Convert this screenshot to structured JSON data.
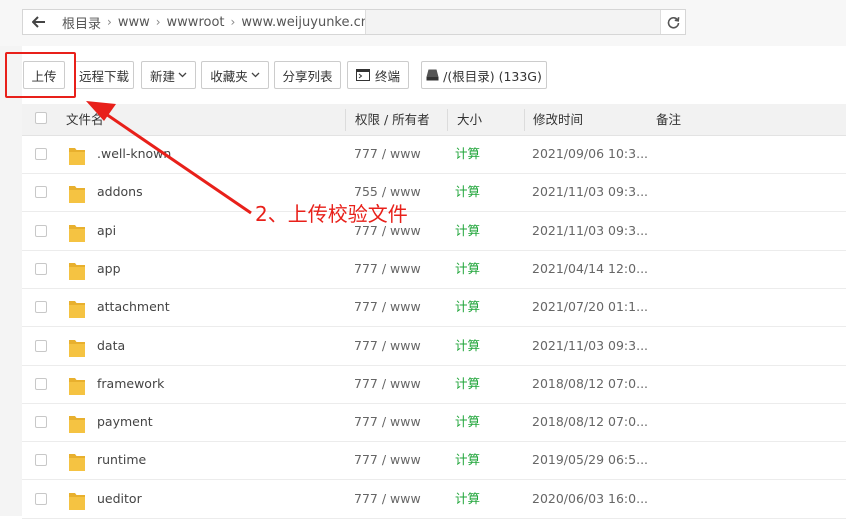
{
  "breadcrumb": [
    "根目录",
    "www",
    "wwwroot",
    "www.weijuyunke.cn"
  ],
  "toolbar": {
    "upload": "上传",
    "remote_download": "远程下载",
    "new": "新建",
    "favorites": "收藏夹",
    "share_list": "分享列表",
    "terminal": "终端",
    "disk": "/(根目录) (133G)"
  },
  "table": {
    "headers": {
      "name": "文件名",
      "perm": "权限 / 所有者",
      "size": "大小",
      "mtime": "修改时间",
      "note": "备注"
    },
    "rows": [
      {
        "name": ".well-known",
        "perm": "777 / www",
        "size": "计算",
        "mtime": "2021/09/06 10:3..."
      },
      {
        "name": "addons",
        "perm": "755 / www",
        "size": "计算",
        "mtime": "2021/11/03 09:3..."
      },
      {
        "name": "api",
        "perm": "777 / www",
        "size": "计算",
        "mtime": "2021/11/03 09:3..."
      },
      {
        "name": "app",
        "perm": "777 / www",
        "size": "计算",
        "mtime": "2021/04/14 12:0..."
      },
      {
        "name": "attachment",
        "perm": "777 / www",
        "size": "计算",
        "mtime": "2021/07/20 01:1..."
      },
      {
        "name": "data",
        "perm": "777 / www",
        "size": "计算",
        "mtime": "2021/11/03 09:3..."
      },
      {
        "name": "framework",
        "perm": "777 / www",
        "size": "计算",
        "mtime": "2018/08/12 07:0..."
      },
      {
        "name": "payment",
        "perm": "777 / www",
        "size": "计算",
        "mtime": "2018/08/12 07:0..."
      },
      {
        "name": "runtime",
        "perm": "777 / www",
        "size": "计算",
        "mtime": "2019/05/29 06:5..."
      },
      {
        "name": "ueditor",
        "perm": "777 / www",
        "size": "计算",
        "mtime": "2020/06/03 16:0..."
      }
    ]
  },
  "annotation": "2、上传校验文件",
  "colors": {
    "accent_red": "#e8201a",
    "size_green": "#20a53a",
    "folder_yellow": "#f5c342"
  }
}
